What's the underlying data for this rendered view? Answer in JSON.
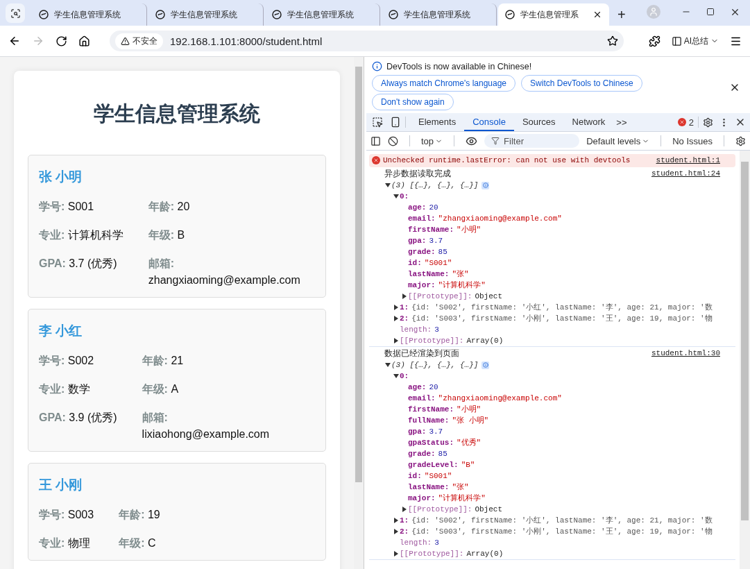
{
  "browser": {
    "tabs": [
      {
        "title": "学生信息管理系统",
        "selected": false
      },
      {
        "title": "学生信息管理系统",
        "selected": false
      },
      {
        "title": "学生信息管理系统",
        "selected": false
      },
      {
        "title": "学生信息管理系统",
        "selected": false
      },
      {
        "title": "学生信息管理系",
        "selected": true
      }
    ],
    "new_tab": "+",
    "security": "不安全",
    "url": "192.168.1.101:8000/student.html",
    "ai_button": "AI总结"
  },
  "page": {
    "title": "学生信息管理系统",
    "students": [
      {
        "name": "张 小明",
        "fields": [
          {
            "label": "学号:",
            "value": "S001"
          },
          {
            "label": "年龄:",
            "value": "20"
          },
          {
            "label": "专业:",
            "value": "计算机科学"
          },
          {
            "label": "年级:",
            "value": "B"
          },
          {
            "label": "GPA:",
            "value": "3.7 (优秀)"
          },
          {
            "label": "邮箱:",
            "value": "zhangxiaoming@example.com"
          }
        ]
      },
      {
        "name": "李 小红",
        "fields": [
          {
            "label": "学号:",
            "value": "S002"
          },
          {
            "label": "年龄:",
            "value": "21"
          },
          {
            "label": "专业:",
            "value": "数学"
          },
          {
            "label": "年级:",
            "value": "A"
          },
          {
            "label": "GPA:",
            "value": "3.9 (优秀)"
          },
          {
            "label": "邮箱:",
            "value": "lixiaohong@example.com"
          }
        ]
      },
      {
        "name": "王 小刚",
        "fields": [
          {
            "label": "学号:",
            "value": "S003"
          },
          {
            "label": "年龄:",
            "value": "19"
          },
          {
            "label": "专业:",
            "value": "物理"
          },
          {
            "label": "年级:",
            "value": "C"
          }
        ]
      }
    ]
  },
  "devtools": {
    "infobar": {
      "message": "DevTools is now available in Chinese!",
      "buttons": [
        "Always match Chrome's language",
        "Switch DevTools to Chinese",
        "Don't show again"
      ]
    },
    "tabs": [
      {
        "label": "Elements",
        "selected": false
      },
      {
        "label": "Console",
        "selected": true
      },
      {
        "label": "Sources",
        "selected": false
      },
      {
        "label": "Network",
        "selected": false
      }
    ],
    "more": ">>",
    "error_count": "2",
    "toolbar": {
      "context": "top",
      "filter_placeholder": "Filter",
      "levels": "Default levels",
      "issues": "No Issues"
    },
    "messages": [
      {
        "kind": "error",
        "text": "Unchecked runtime.lastError: can not use with devtools",
        "source": "student.html:1"
      },
      {
        "kind": "log",
        "text": "异步数据读取完成",
        "source": "student.html:24",
        "tree": [
          {
            "kind": "summary",
            "value_text": "(3) [{…}, {…}, {…}]",
            "expanded": true,
            "children": [
              {
                "kind": "entry",
                "key": "0:",
                "expanded": true,
                "children": [
                  {
                    "kind": "prop",
                    "key": "age:",
                    "value": {
                      "kind": "number",
                      "text": "20"
                    }
                  },
                  {
                    "kind": "prop",
                    "key": "email:",
                    "value": {
                      "kind": "string",
                      "text": "\"zhangxiaoming@example.com\""
                    }
                  },
                  {
                    "kind": "prop",
                    "key": "firstName:",
                    "value": {
                      "kind": "string",
                      "text": "\"小明\""
                    }
                  },
                  {
                    "kind": "prop",
                    "key": "gpa:",
                    "value": {
                      "kind": "number",
                      "text": "3.7"
                    }
                  },
                  {
                    "kind": "prop",
                    "key": "grade:",
                    "value": {
                      "kind": "number",
                      "text": "85"
                    }
                  },
                  {
                    "kind": "prop",
                    "key": "id:",
                    "value": {
                      "kind": "string",
                      "text": "\"S001\""
                    }
                  },
                  {
                    "kind": "prop",
                    "key": "lastName:",
                    "value": {
                      "kind": "string",
                      "text": "\"张\""
                    }
                  },
                  {
                    "kind": "prop",
                    "key": "major:",
                    "value": {
                      "kind": "string",
                      "text": "\"计算机科学\""
                    }
                  },
                  {
                    "kind": "internal",
                    "key": "[[Prototype]]:",
                    "value": {
                      "kind": "object",
                      "text": "Object"
                    },
                    "expanded": false
                  }
                ]
              },
              {
                "kind": "entry",
                "key": "1:",
                "expanded": false,
                "preview": "{id: 'S002', firstName: '小红', lastName: '李', age: 21, major: '数"
              },
              {
                "kind": "entry",
                "key": "2:",
                "expanded": false,
                "preview": "{id: 'S003', firstName: '小刚', lastName: '王', age: 19, major: '物"
              },
              {
                "kind": "internal",
                "key": "length:",
                "value": {
                  "kind": "number",
                  "text": "3"
                }
              },
              {
                "kind": "internal",
                "key": "[[Prototype]]:",
                "value": {
                  "kind": "object",
                  "text": "Array(0)"
                },
                "expanded": false
              }
            ]
          }
        ]
      },
      {
        "kind": "log",
        "text": "数据已经渲染到页面",
        "source": "student.html:30",
        "tree": [
          {
            "kind": "summary",
            "value_text": "(3) [{…}, {…}, {…}]",
            "expanded": true,
            "children": [
              {
                "kind": "entry",
                "key": "0:",
                "expanded": true,
                "children": [
                  {
                    "kind": "prop",
                    "key": "age:",
                    "value": {
                      "kind": "number",
                      "text": "20"
                    }
                  },
                  {
                    "kind": "prop",
                    "key": "email:",
                    "value": {
                      "kind": "string",
                      "text": "\"zhangxiaoming@example.com\""
                    }
                  },
                  {
                    "kind": "prop",
                    "key": "firstName:",
                    "value": {
                      "kind": "string",
                      "text": "\"小明\""
                    }
                  },
                  {
                    "kind": "prop",
                    "key": "fullName:",
                    "value": {
                      "kind": "string",
                      "text": "\"张 小明\""
                    }
                  },
                  {
                    "kind": "prop",
                    "key": "gpa:",
                    "value": {
                      "kind": "number",
                      "text": "3.7"
                    }
                  },
                  {
                    "kind": "prop",
                    "key": "gpaStatus:",
                    "value": {
                      "kind": "string",
                      "text": "\"优秀\""
                    }
                  },
                  {
                    "kind": "prop",
                    "key": "grade:",
                    "value": {
                      "kind": "number",
                      "text": "85"
                    }
                  },
                  {
                    "kind": "prop",
                    "key": "gradeLevel:",
                    "value": {
                      "kind": "string",
                      "text": "\"B\""
                    }
                  },
                  {
                    "kind": "prop",
                    "key": "id:",
                    "value": {
                      "kind": "string",
                      "text": "\"S001\""
                    }
                  },
                  {
                    "kind": "prop",
                    "key": "lastName:",
                    "value": {
                      "kind": "string",
                      "text": "\"张\""
                    }
                  },
                  {
                    "kind": "prop",
                    "key": "major:",
                    "value": {
                      "kind": "string",
                      "text": "\"计算机科学\""
                    }
                  },
                  {
                    "kind": "internal",
                    "key": "[[Prototype]]:",
                    "value": {
                      "kind": "object",
                      "text": "Object"
                    },
                    "expanded": false
                  }
                ]
              },
              {
                "kind": "entry",
                "key": "1:",
                "expanded": false,
                "preview": "{id: 'S002', firstName: '小红', lastName: '李', age: 21, major: '数"
              },
              {
                "kind": "entry",
                "key": "2:",
                "expanded": false,
                "preview": "{id: 'S003', firstName: '小刚', lastName: '王', age: 19, major: '物"
              },
              {
                "kind": "internal",
                "key": "length:",
                "value": {
                  "kind": "number",
                  "text": "3"
                }
              },
              {
                "kind": "internal",
                "key": "[[Prototype]]:",
                "value": {
                  "kind": "object",
                  "text": "Array(0)"
                },
                "expanded": false
              }
            ]
          }
        ]
      }
    ]
  }
}
